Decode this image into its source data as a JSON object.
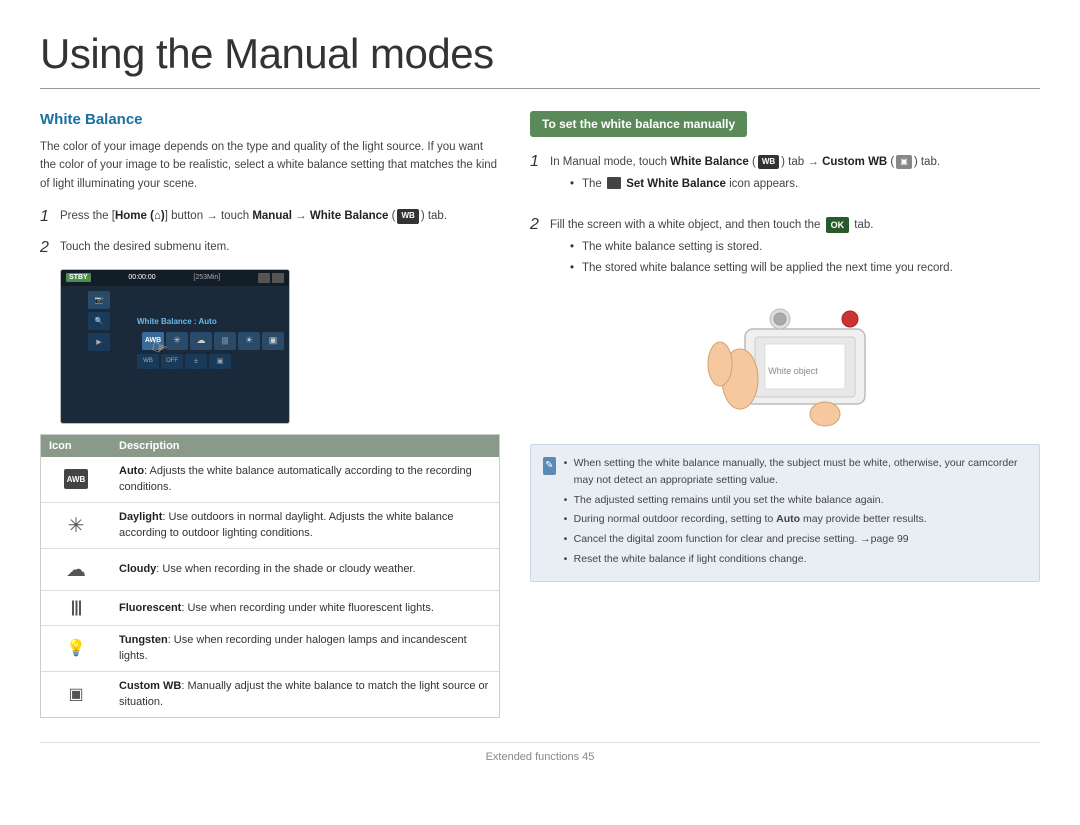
{
  "page": {
    "title": "Using the Manual modes",
    "footer": "Extended functions  45"
  },
  "left": {
    "section_heading": "White Balance",
    "intro": "The color of your image depends on the type and quality of the light source. If you want the color of your image to be realistic, select a white balance setting that matches the kind of light illuminating your scene.",
    "step1_text": "Press the [Home (⌂)] button → touch Manual → White Balance (",
    "step1_suffix": ") tab.",
    "step2_text": "Touch the desired submenu item.",
    "camera_screen": {
      "stby": "STBY",
      "time": "00:00:00",
      "memory": "[253Min]",
      "wb_label": "White Balance : Auto"
    },
    "table": {
      "col1": "Icon",
      "col2": "Description",
      "rows": [
        {
          "icon_label": "AWB",
          "desc_bold": "Auto",
          "desc": ": Adjusts the white balance automatically according to the recording conditions."
        },
        {
          "icon_label": "☀",
          "desc_bold": "Daylight",
          "desc": ": Use outdoors in normal daylight. Adjusts the white balance according to outdoor lighting conditions."
        },
        {
          "icon_label": "☁",
          "desc_bold": "Cloudy",
          "desc": ": Use when recording in the shade or cloudy weather."
        },
        {
          "icon_label": "|||",
          "desc_bold": "Fluorescent",
          "desc": ": Use when recording under white fluorescent lights."
        },
        {
          "icon_label": "✳",
          "desc_bold": "Tungsten",
          "desc": ": Use when recording under halogen lamps and incandescent lights."
        },
        {
          "icon_label": "▣",
          "desc_bold": "Custom WB",
          "desc": ": Manually adjust the white balance to match the light source or situation."
        }
      ]
    }
  },
  "right": {
    "header": "To set the white balance manually",
    "step1": {
      "num": "1",
      "text": "In Manual mode, touch ",
      "bold1": "White Balance",
      "icon1": "WB",
      "middle": ") tab →",
      "bold2": "Custom WB (",
      "icon2": "▣",
      "end": ") tab."
    },
    "step1_bullet": "The  Set White Balance icon appears.",
    "step2": {
      "num": "2",
      "text": "Fill the screen with a white object, and then touch the",
      "ok": "OK",
      "end": " tab."
    },
    "step2_bullets": [
      "The white balance setting is stored.",
      "The stored white balance setting will be applied the next time you record."
    ],
    "note_items": [
      "When setting the white balance manually, the subject must be white, otherwise, your camcorder may not detect an appropriate setting value.",
      "The adjusted setting remains until you set the white balance again.",
      "During normal outdoor recording, setting to Auto may provide better results.",
      "Cancel the digital zoom function for clear and precise setting. →page 99",
      "Reset the white balance if light conditions change."
    ]
  }
}
